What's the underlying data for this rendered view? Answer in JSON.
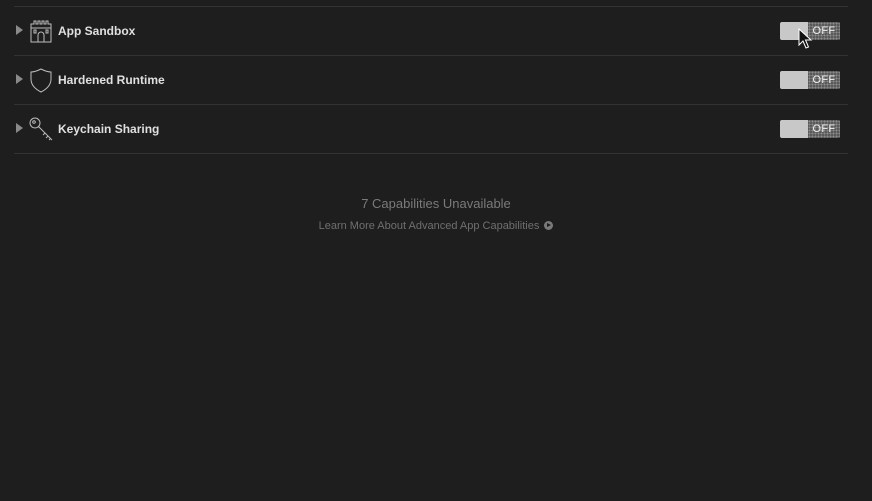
{
  "capabilities": [
    {
      "name": "App Sandbox",
      "icon": "castle-icon",
      "toggle": "OFF"
    },
    {
      "name": "Hardened Runtime",
      "icon": "shield-icon",
      "toggle": "OFF"
    },
    {
      "name": "Keychain Sharing",
      "icon": "key-icon",
      "toggle": "OFF"
    }
  ],
  "footer": {
    "unavailable_text": "7 Capabilities Unavailable",
    "learn_more_text": "Learn More About Advanced App Capabilities",
    "learn_more_icon": "arrow-circle-icon"
  },
  "colors": {
    "background": "#1e1e1e",
    "divider": "#333333",
    "toggle_knob": "#c8c8c8",
    "toggle_track": "#5a5a5a"
  }
}
